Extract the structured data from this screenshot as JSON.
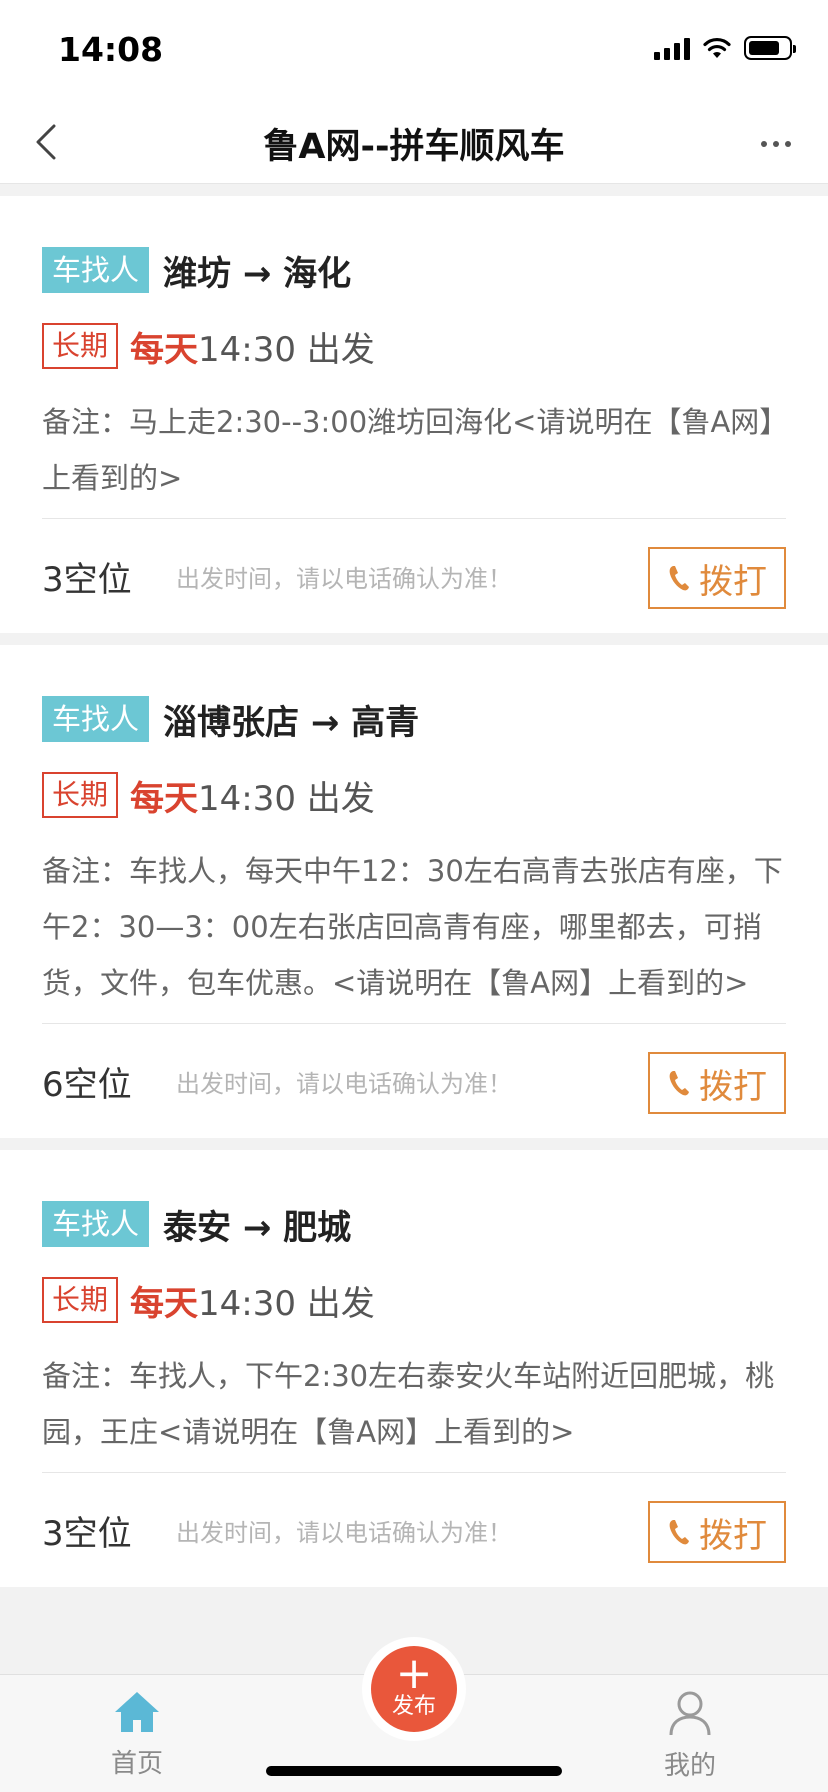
{
  "status_bar": {
    "time": "14:08"
  },
  "nav": {
    "title": "鲁A网--拼车顺风车"
  },
  "listings": [
    {
      "type": "车找人",
      "route": "潍坊 → 海化",
      "frequency": "长期",
      "days": "每天",
      "time": "14:30 出发",
      "note": "备注：马上走2:30--3:00潍坊回海化<请说明在【鲁A网】上看到的>",
      "seats": "3空位",
      "hint": "出发时间，请以电话确认为准！",
      "call_label": "拨打"
    },
    {
      "type": "车找人",
      "route": "淄博张店 → 高青",
      "frequency": "长期",
      "days": "每天",
      "time": "14:30 出发",
      "note": "备注：车找人，每天中午12：30左右高青去张店有座，下午2：30—3：00左右张店回高青有座，哪里都去，可捎货，文件，包车优惠。<请说明在【鲁A网】上看到的>",
      "seats": "6空位",
      "hint": "出发时间，请以电话确认为准！",
      "call_label": "拨打"
    },
    {
      "type": "车找人",
      "route": "泰安 → 肥城",
      "frequency": "长期",
      "days": "每天",
      "time": "14:30 出发",
      "note": "备注：车找人，下午2:30左右泰安火车站附近回肥城，桃园，王庄<请说明在【鲁A网】上看到的>",
      "seats": "3空位",
      "hint": "出发时间，请以电话确认为准！",
      "call_label": "拨打"
    }
  ],
  "tab_bar": {
    "home": "首页",
    "publish": "发布",
    "mine": "我的"
  },
  "colors": {
    "type_tag": "#6cc7d4",
    "accent_red": "#d9432f",
    "call_orange": "#e08a3c",
    "home_blue": "#5bb8d6"
  }
}
